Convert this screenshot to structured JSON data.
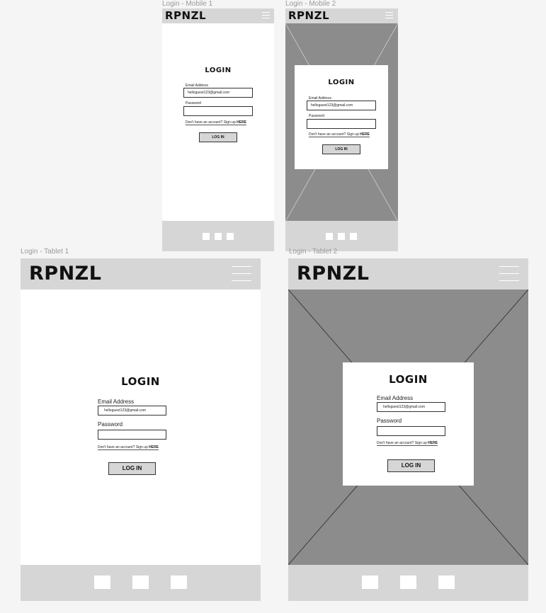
{
  "brand": "RPNZL",
  "frames": {
    "mobile1": "Login - Mobile 1",
    "mobile2": "Login - Mobile 2",
    "tablet1": "Login - Tablet 1",
    "tablet2": "Login - Tablet 2"
  },
  "login": {
    "title": "LOGIN",
    "email_label": "Email Address",
    "email_value": "helloguest123@gmail.com",
    "password_label": "Password",
    "password_value": "",
    "signup_text": "Don't have an account? Sign up",
    "signup_link": "HERE",
    "button": "LOG IN"
  },
  "icons": {
    "menu": "hamburger-menu-icon",
    "image_placeholder": "image-placeholder-icon",
    "footer_item": "footer-square-icon"
  },
  "colors": {
    "bar": "#d6d6d6",
    "image_placeholder": "#8c8c8c",
    "background": "#f5f5f5"
  }
}
